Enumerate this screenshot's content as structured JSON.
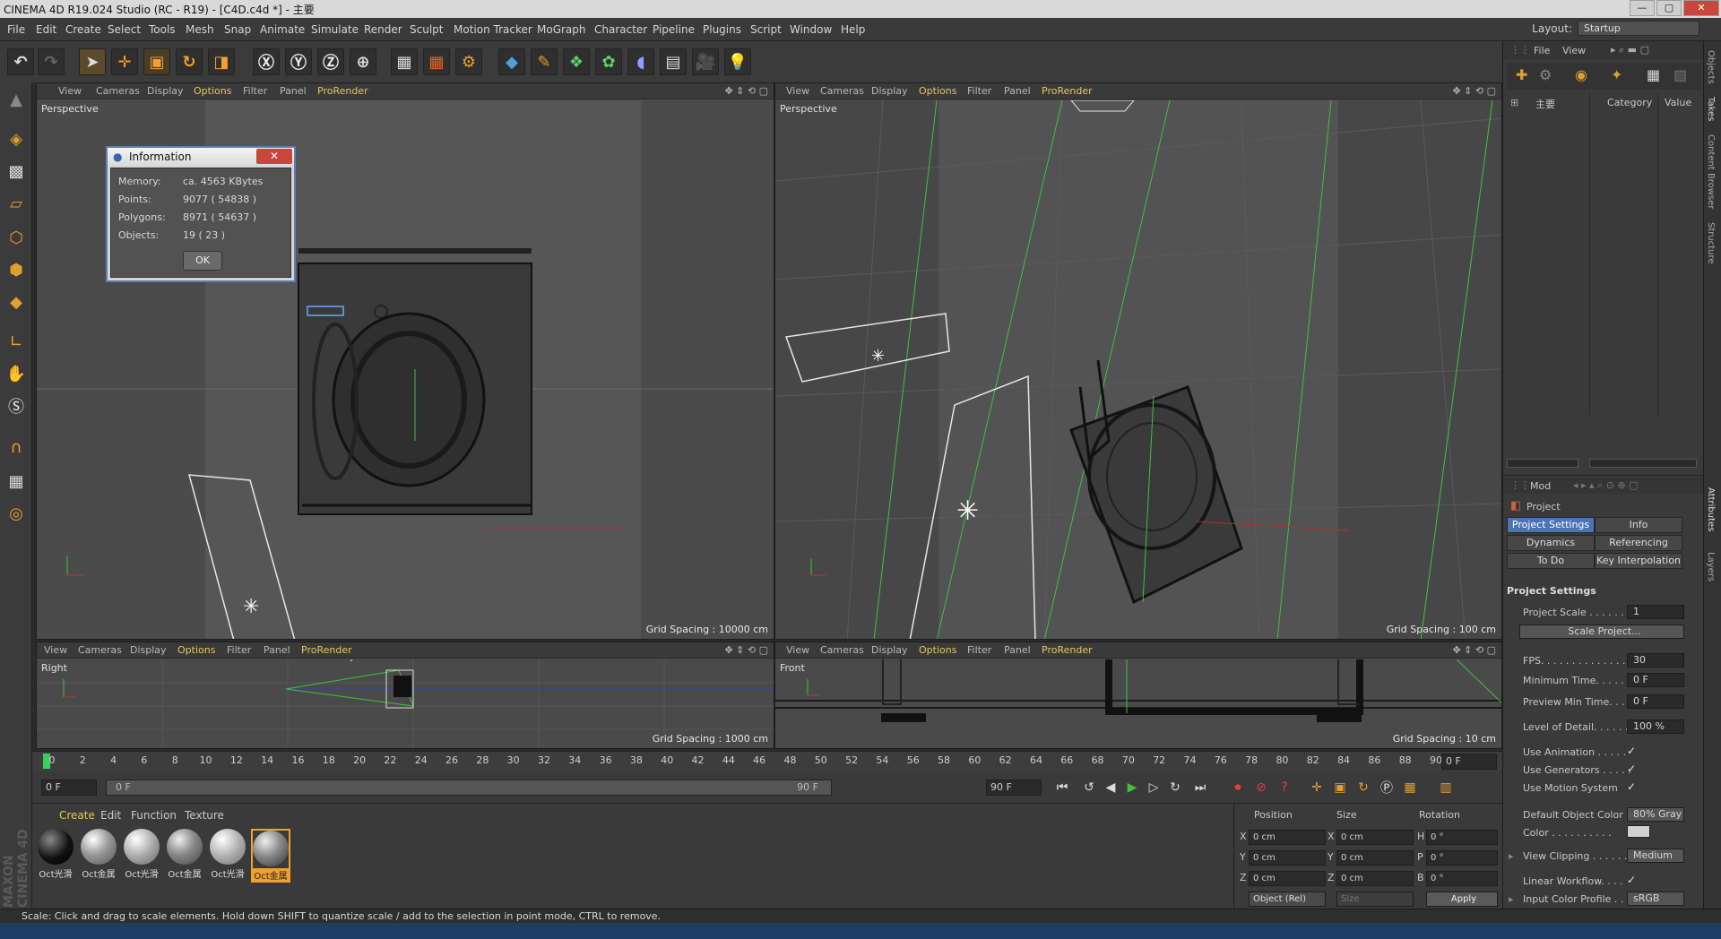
{
  "window": {
    "title": "CINEMA 4D R19.024 Studio (RC - R19) - [C4D.c4d *] - 主要",
    "min": "—",
    "max": "▢",
    "close": "✕"
  },
  "menu": [
    "File",
    "Edit",
    "Create",
    "Select",
    "Tools",
    "Mesh",
    "Snap",
    "Animate",
    "Simulate",
    "Render",
    "Sculpt",
    "Motion Tracker",
    "MoGraph",
    "Character",
    "Pipeline",
    "Plugins",
    "Script",
    "Window",
    "Help"
  ],
  "layout": {
    "label": "Layout:",
    "value": "Startup"
  },
  "viewport_menu": [
    "View",
    "Cameras",
    "Display",
    "Options",
    "Filter",
    "Panel",
    "ProRender"
  ],
  "viewports": [
    {
      "name": "Perspective",
      "grid": "Grid Spacing : 10000 cm"
    },
    {
      "name": "Perspective",
      "grid": "Grid Spacing : 100 cm"
    },
    {
      "name": "Right",
      "grid": "Grid Spacing : 1000 cm"
    },
    {
      "name": "Front",
      "grid": "Grid Spacing : 10 cm"
    }
  ],
  "info_dialog": {
    "title": "Information",
    "rows": [
      {
        "label": "Memory:",
        "value": "ca. 4563 KBytes"
      },
      {
        "label": "Points:",
        "value": "9077 ( 54838 )"
      },
      {
        "label": "Polygons:",
        "value": "8971 ( 54637 )"
      },
      {
        "label": "Objects:",
        "value": "19 ( 23 )"
      }
    ],
    "ok": "OK"
  },
  "timeline": {
    "ticks": [
      "0",
      "2",
      "4",
      "6",
      "8",
      "10",
      "12",
      "14",
      "16",
      "18",
      "20",
      "22",
      "24",
      "26",
      "28",
      "30",
      "32",
      "34",
      "36",
      "38",
      "40",
      "42",
      "44",
      "46",
      "48",
      "50",
      "52",
      "54",
      "56",
      "58",
      "60",
      "62",
      "64",
      "66",
      "68",
      "70",
      "72",
      "74",
      "76",
      "78",
      "80",
      "82",
      "84",
      "86",
      "88",
      "90"
    ],
    "current": "0 F",
    "start": "0 F",
    "range_start": "0 F",
    "range_end": "90 F",
    "end": "90 F"
  },
  "material_menu": [
    "Create",
    "Edit",
    "Function",
    "Texture"
  ],
  "materials": [
    "Oct光滑",
    "Oct金属",
    "Oct光滑",
    "Oct金属",
    "Oct光滑",
    "Oct金属"
  ],
  "coords": {
    "headers": [
      "Position",
      "Size",
      "Rotation"
    ],
    "axes_pos": [
      "X",
      "Y",
      "Z"
    ],
    "axes_size": [
      "X",
      "Y",
      "Z"
    ],
    "axes_rot": [
      "H",
      "P",
      "B"
    ],
    "pos": [
      "0 cm",
      "0 cm",
      "0 cm"
    ],
    "size": [
      "0 cm",
      "0 cm",
      "0 cm"
    ],
    "rot": [
      "0 °",
      "0 °",
      "0 °"
    ],
    "mode": "Object (Rel)",
    "size_mode": "Size",
    "apply": "Apply"
  },
  "objects": {
    "menu": [
      "File",
      "View"
    ],
    "item": "主要",
    "col_category": "Category",
    "col_value": "Value"
  },
  "attributes": {
    "mode": "Mod",
    "title": "Project",
    "tabs": [
      "Project Settings",
      "Info",
      "Dynamics",
      "Referencing",
      "To Do",
      "Key Interpolation"
    ],
    "section": "Project Settings",
    "scale_label": "Project Scale . . . . . . .",
    "scale_value": "1",
    "scale_btn": "Scale Project...",
    "fps_label": "FPS. . . . . . . . . . . . . .",
    "fps": "30",
    "min_time_label": "Minimum Time. . . . . .",
    "min_time": "0 F",
    "prev_min_label": "Preview Min Time. . . .",
    "prev_min": "0 F",
    "lod_label": "Level of Detail. . . . . .",
    "lod": "100 %",
    "use_anim": "Use Animation . . . . .",
    "use_gen": "Use Generators . . . . .",
    "use_motion": "Use Motion System",
    "check": "✓",
    "doc_label": "Default Object Color",
    "doc_value": "80% Gray",
    "color_label": "Color . . . . . . . . . .",
    "clip_label": "View Clipping . . . . . .",
    "clip_value": "Medium",
    "lin_label": "Linear Workflow. . . .",
    "icp_label": "Input Color Profile . .",
    "icp_value": "sRGB"
  },
  "side_tabs": [
    "Objects",
    "Takes",
    "Content Browser",
    "Structure",
    "Attributes",
    "Layers"
  ],
  "status": "Scale: Click and drag to scale elements. Hold down SHIFT to quantize scale / add to the selection in point mode, CTRL to remove.",
  "brand": "MAXON CINEMA 4D"
}
